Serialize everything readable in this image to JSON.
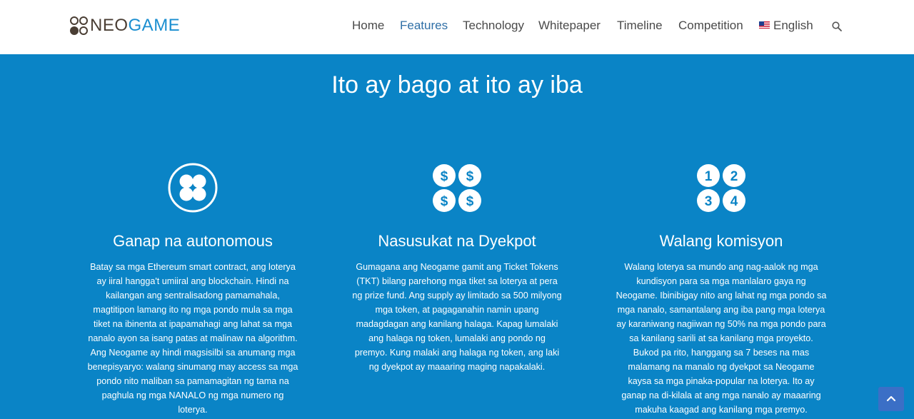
{
  "brand": {
    "name_part1": "NEO",
    "name_part2": "GAME"
  },
  "nav": {
    "items": [
      "Home",
      "Features",
      "Technology",
      "Whitepaper",
      "Timeline",
      "Competition"
    ],
    "active": "Features",
    "language": "English"
  },
  "section": {
    "title": "Ito ay bago at ito ay iba"
  },
  "features": [
    {
      "icon": "four-circles-icon",
      "title": "Ganap na autonomous",
      "text": "Batay sa mga Ethereum smart contract, ang loterya ay iiral hangga't umiiral ang blockchain. Hindi na kailangan ang sentralisadong pamamahala, magtitipon lamang ito ng mga pondo mula sa mga tiket na ibinenta at ipapamahagi ang lahat sa mga nanalo ayon sa isang patas at malinaw na algorithm. Ang Neogame ay hindi magsisilbi sa anumang mga benepisyaryo: walang sinumang may access sa mga pondo nito maliban sa pamamagitan ng tama na paghula ng mga NANALO ng mga numero ng loterya."
    },
    {
      "icon": "dollar-coins-icon",
      "icon_glyph": "$",
      "title": "Nasusukat na Dyekpot",
      "text": "Gumagana ang Neogame gamit ang Ticket Tokens (TKT) bilang parehong mga tiket sa loterya at pera ng prize fund. Ang supply ay limitado sa 500 milyong mga token, at pagaganahin namin upang madagdagan ang kanilang halaga. Kapag lumalaki ang halaga ng token, lumalaki ang pondo ng premyo. Kung malaki ang halaga ng token, ang laki ng dyekpot ay maaaring maging napakalaki."
    },
    {
      "icon": "numbered-circles-icon",
      "icon_numbers": [
        "1",
        "2",
        "3",
        "4"
      ],
      "title": "Walang komisyon",
      "text": "Walang loterya sa mundo ang nag-aalok ng mga kundisyon para sa mga manlalaro gaya ng Neogame. Ibinibigay nito ang lahat ng mga pondo sa mga nanalo, samantalang ang iba pang mga loterya ay karaniwang nagiiwan ng 50% na mga pondo para sa kanilang sarili at sa kanilang mga proyekto. Bukod pa rito, hanggang sa 7 beses na mas malamang na manalo ng dyekpot sa Neogame kaysa sa mga pinaka-popular na loterya. Ito ay ganap na di-kilala at ang mga nanalo ay maaaring makuha kaagad ang kanilang mga premyo."
    }
  ],
  "colors": {
    "background": "#0a84c6",
    "navbar": "#ffffff",
    "nav_active": "#2f6fa6",
    "scroll_button": "#3b6fc6"
  }
}
